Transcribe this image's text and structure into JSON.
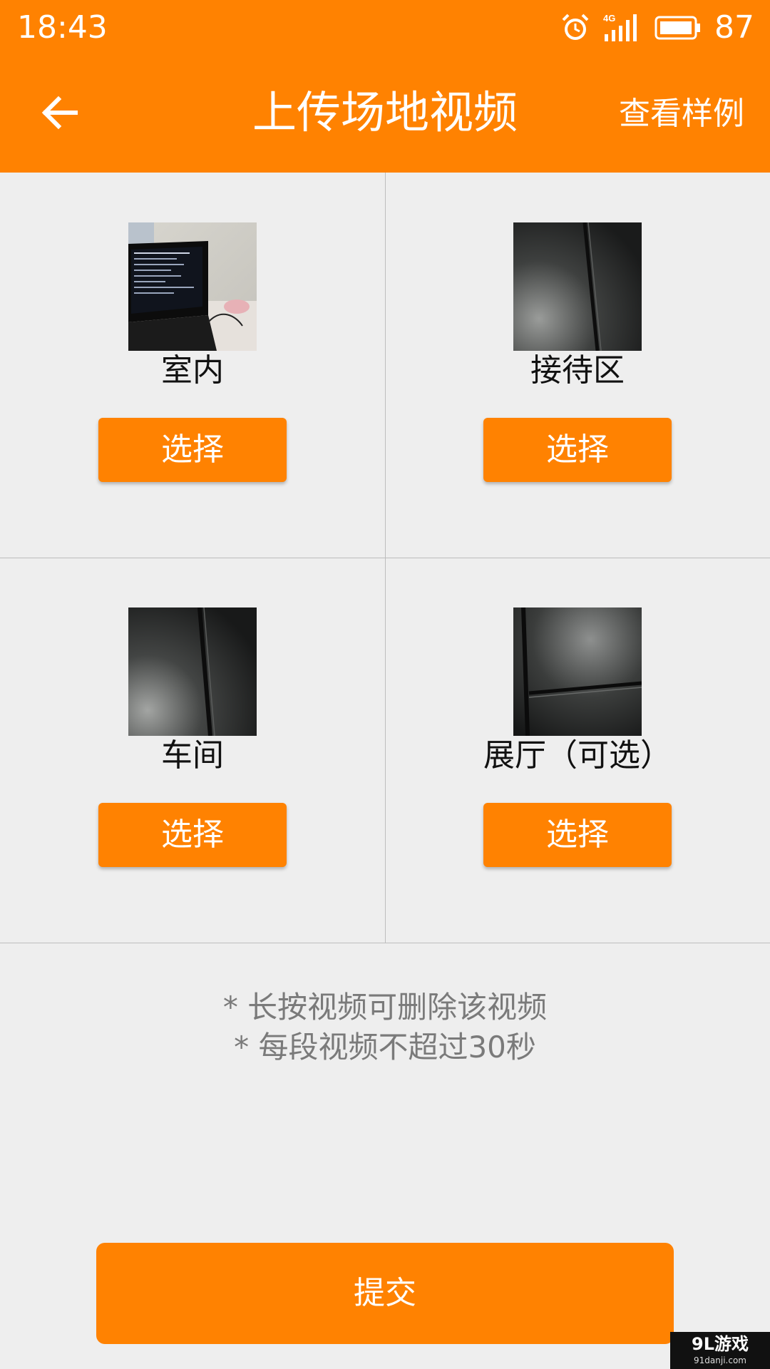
{
  "status_bar": {
    "time": "18:43",
    "network": "4G",
    "battery": "87",
    "icons": [
      "alarm-icon",
      "signal-icon",
      "battery-icon"
    ]
  },
  "app_bar": {
    "title": "上传场地视频",
    "action": "查看样例",
    "back_icon": "arrow-left-icon"
  },
  "grid": {
    "cells": [
      {
        "label": "室内",
        "button": "选择",
        "thumbnail": "indoor-video-thumbnail"
      },
      {
        "label": "接待区",
        "button": "选择",
        "thumbnail": "reception-video-thumbnail"
      },
      {
        "label": "车间",
        "button": "选择",
        "thumbnail": "workshop-video-thumbnail"
      },
      {
        "label": "展厅（可选）",
        "button": "选择",
        "thumbnail": "showroom-video-thumbnail"
      }
    ]
  },
  "notes": [
    "* 长按视频可删除该视频",
    "* 每段视频不超过30秒"
  ],
  "submit_label": "提交",
  "watermark": {
    "main": "9L游戏",
    "sub": "91danji.com"
  },
  "colors": {
    "accent": "#ff8201",
    "background": "#eeeeee",
    "divider": "#bdbdbd",
    "note_text": "#7a7a7a"
  }
}
